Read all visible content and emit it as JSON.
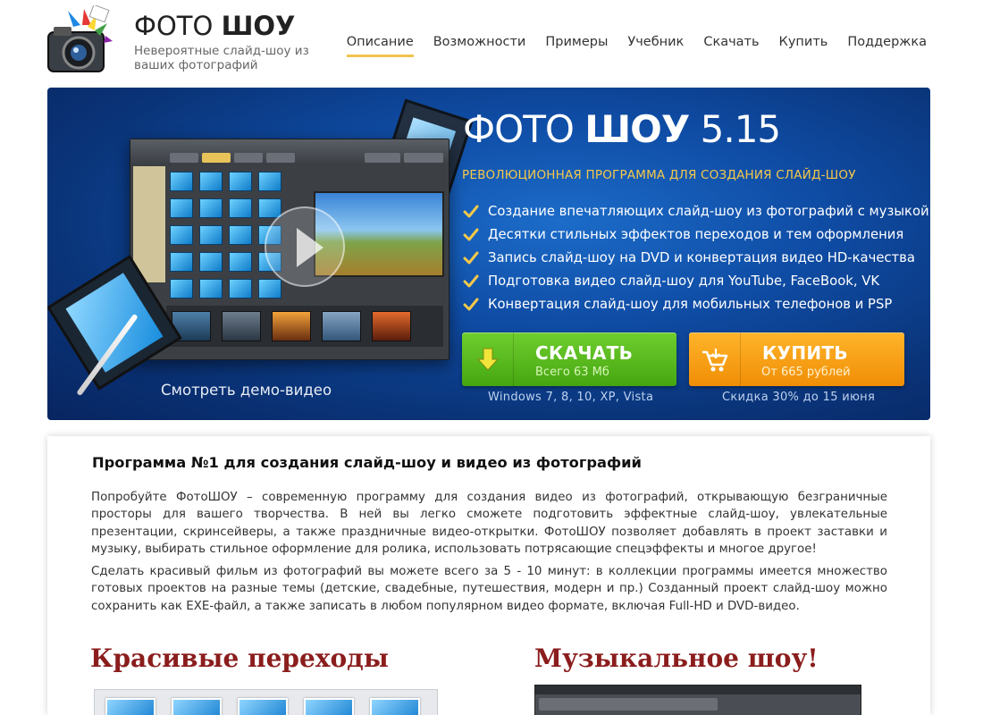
{
  "brand": {
    "name_light": "ФОТО",
    "name_bold": "ШОУ",
    "tagline": "Невероятные слайд-шоу из ваших фотографий"
  },
  "nav": {
    "items": [
      {
        "label": "Описание",
        "active": true
      },
      {
        "label": "Возможности"
      },
      {
        "label": "Примеры"
      },
      {
        "label": "Учебник"
      },
      {
        "label": "Скачать"
      },
      {
        "label": "Купить"
      },
      {
        "label": "Поддержка"
      }
    ]
  },
  "hero": {
    "title_light": "ФОТО",
    "title_bold": "ШОУ",
    "version": "5.15",
    "subtitle": "РЕВОЛЮЦИОННАЯ ПРОГРАММА ДЛЯ СОЗДАНИЯ СЛАЙД-ШОУ",
    "features": [
      "Создание впечатляющих слайд-шоу из фотографий с музыкой",
      "Десятки стильных эффектов переходов и тем оформления",
      "Запись слайд-шоу на DVD и конвертация видео HD-качества",
      "Подготовка видео слайд-шоу для YouTube, FaceBook, VK",
      "Конвертация слайд-шоу для мобильных телефонов и PSP"
    ],
    "demo_link": "Смотреть демо-видео",
    "download": {
      "label": "СКАЧАТЬ",
      "sub": "Всего 63 Мб",
      "note": "Windows 7, 8, 10, XP, Vista"
    },
    "buy": {
      "label": "КУПИТЬ",
      "sub": "От 665 рублей",
      "note": "Скидка 30% до 15 июня"
    }
  },
  "content": {
    "title": "Программа №1 для создания слайд-шоу и видео из фотографий",
    "paragraph1": "Попробуйте ФотоШОУ – современную программу для создания видео из фотографий, открывающую безграничные просторы для вашего творчества. В ней вы легко сможете подготовить эффектные слайд-шоу, увлекательные презентации, скринсейверы, а также праздничные видео-открытки. ФотоШОУ позволяет добавлять в проект заставки и музыку, выбирать стильное оформление для ролика, использовать потрясающие спецэффекты и многое другое!",
    "paragraph2": "Сделать красивый фильм из фотографий вы можете всего за 5 - 10 минут: в коллекции программы имеется множество готовых проектов на разные темы (детские, свадебные, путешествия, модерн и пр.) Созданный проект слайд-шоу можно сохранить как EXE-файл, а также записать в любом популярном видео формате, включая Full-HD и DVD-видео.",
    "section_left": "Красивые переходы",
    "section_right": "Музыкальное шоу!"
  },
  "colors": {
    "accent_yellow": "#f2c44e",
    "download_green": "#45a611",
    "buy_orange": "#f08e06",
    "heading_red": "#8b1d1d",
    "hero_blue": "#0f4da6"
  }
}
